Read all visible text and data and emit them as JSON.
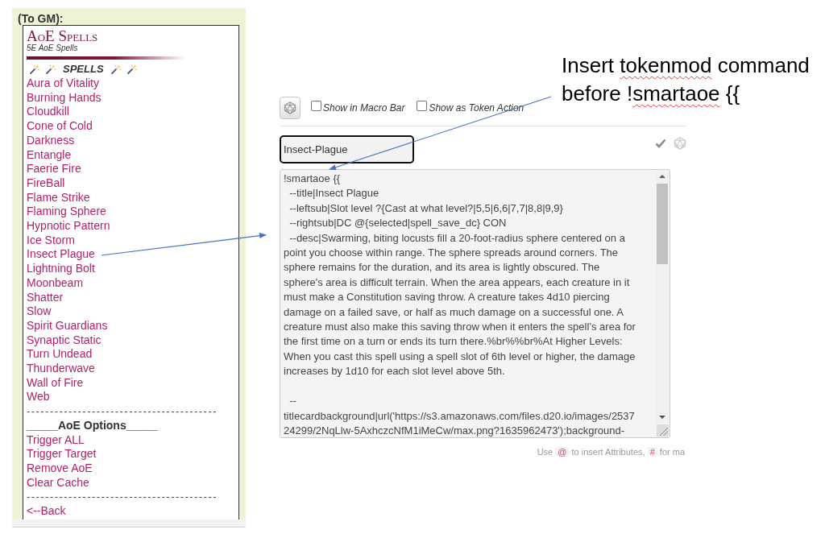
{
  "chat_panel": {
    "recipient": "(To GM):",
    "menu": {
      "title": "AoE Spells",
      "subtitle": "5E AoE Spells",
      "section_heading": "SPELLS",
      "items": [
        {
          "kind": "link",
          "text": "Aura of Vitality"
        },
        {
          "kind": "link",
          "text": "Burning Hands"
        },
        {
          "kind": "link",
          "text": "Cloudkill"
        },
        {
          "kind": "link",
          "text": "Cone of Cold"
        },
        {
          "kind": "link",
          "text": "Darkness"
        },
        {
          "kind": "link",
          "text": "Entangle"
        },
        {
          "kind": "link",
          "text": "Faerie Fire"
        },
        {
          "kind": "link",
          "text": "FireBall"
        },
        {
          "kind": "link",
          "text": "Flame Strike"
        },
        {
          "kind": "link",
          "text": "Flaming Sphere"
        },
        {
          "kind": "link",
          "text": "Hypnotic Pattern"
        },
        {
          "kind": "link",
          "text": "Ice Storm"
        },
        {
          "kind": "link",
          "text": "Insect Plague"
        },
        {
          "kind": "link",
          "text": "Lightning Bolt"
        },
        {
          "kind": "link",
          "text": "Moonbeam"
        },
        {
          "kind": "link",
          "text": "Shatter"
        },
        {
          "kind": "link",
          "text": "Slow"
        },
        {
          "kind": "link",
          "text": "Spirit Guardians"
        },
        {
          "kind": "link",
          "text": "Synaptic Static"
        },
        {
          "kind": "link",
          "text": "Turn Undead"
        },
        {
          "kind": "link",
          "text": "Thunderwave"
        },
        {
          "kind": "link",
          "text": "Wall of Fire"
        },
        {
          "kind": "link",
          "text": "Web"
        },
        {
          "kind": "separator",
          "text": "-----------------------------------------"
        },
        {
          "kind": "heading",
          "text": "_____AoE Options_____"
        },
        {
          "kind": "link",
          "text": "Trigger ALL"
        },
        {
          "kind": "link",
          "text": "Trigger Target"
        },
        {
          "kind": "link",
          "text": "Remove AoE"
        },
        {
          "kind": "link",
          "text": "Clear Cache"
        },
        {
          "kind": "separator",
          "text": "-----------------------------------------"
        },
        {
          "kind": "link",
          "text": "<--Back"
        }
      ]
    }
  },
  "macro_editor": {
    "options": [
      {
        "label": "Show in Macro Bar",
        "checked": false
      },
      {
        "label": "Show as Token Action",
        "checked": false
      }
    ],
    "name_field": {
      "value": "Insect-Plague"
    },
    "action_field": {
      "value": "!smartaoe {{\n  --title|Insect Plague\n  --leftsub|Slot level ?{Cast at what level?|5,5|6,6|7,7|8,8|9,9}\n  --rightsub|DC @{selected|spell_save_dc} CON\n  --desc|Swarming, biting locusts fill a 20-foot-radius sphere centered on a\npoint you choose within range. The sphere spreads around corners. The\nsphere remains for the duration, and its area is lightly obscured. The\nsphere's area is difficult terrain. When the area appears, each creature in it\nmust make a Constitution saving throw. A creature takes 4d10 piercing\ndamage on a failed save, or half as much damage on a successful one. A\ncreature must also make this saving throw when it enters the spell’s area for\nthe first time on a turn or ends its turn there.%br%%br%At Higher Levels:\nWhen you cast this spell using a spell slot of 6th level or higher, the damage\nincreases by 1d10 for each slot level above 5th.\n\n  --\ntitlecardbackground|url('https://s3.amazonaws.com/files.d20.io/images/2537\n24299/2NqLlw-5AxhczcNfM1iMeCw/max.png?1635962473');background-"
    },
    "hint": [
      {
        "kind": "text",
        "text": "Use "
      },
      {
        "kind": "code",
        "text": "@"
      },
      {
        "kind": "text",
        "text": " to insert Attributes, "
      },
      {
        "kind": "code",
        "text": "#"
      },
      {
        "kind": "text",
        "text": " for ma"
      }
    ]
  },
  "annotation": {
    "lines": [
      [
        {
          "text": "Insert ",
          "misspelled": false
        },
        {
          "text": "tokenmod",
          "misspelled": true
        },
        {
          "text": " command",
          "misspelled": false
        }
      ],
      [
        {
          "text": "before !",
          "misspelled": false
        },
        {
          "text": "smartaoe",
          "misspelled": true
        },
        {
          "text": " {{",
          "misspelled": false
        }
      ]
    ]
  }
}
